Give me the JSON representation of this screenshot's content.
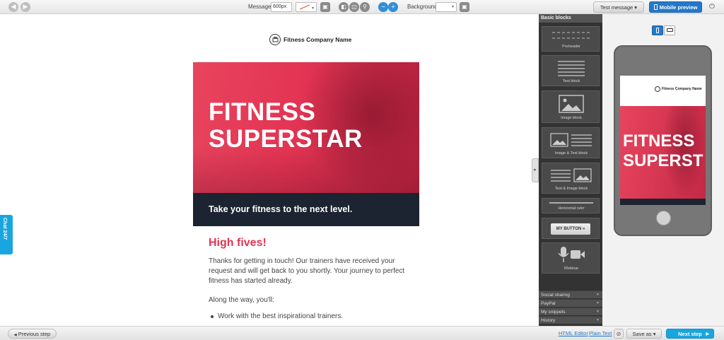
{
  "toolbar": {
    "message_label": "Message",
    "width_value": "600px",
    "background_label": "Background",
    "test_message_label": "Test message",
    "mobile_preview_label": "Mobile preview"
  },
  "email": {
    "company_name": "Fitness Company Name",
    "hero_title_line1": "FITNESS",
    "hero_title_line2": "SUPERSTAR",
    "hero_tagline": "Take your fitness to the next level.",
    "heading": "High fives!",
    "paragraph": "Thanks for getting in touch! Our trainers have received your request and will get back to you shortly. Your journey to perfect fitness has started already.",
    "paragraph2": "Along the way, you'll:",
    "bullets": [
      "Work with the best inspirational trainers."
    ]
  },
  "chat_tab_label": "Chat 24/7",
  "blocks_panel": {
    "header": "Basic blocks",
    "blocks": [
      {
        "label": "Preheader"
      },
      {
        "label": "Text block"
      },
      {
        "label": "Image block"
      },
      {
        "label": "Image & Text block"
      },
      {
        "label": "Text & Image block"
      },
      {
        "label": "Horizontal ruler"
      },
      {
        "label": "MY BUTTON »"
      },
      {
        "label": "Webinar"
      }
    ],
    "sections": [
      "Social sharing",
      "PayPal",
      "My snippets",
      "History"
    ]
  },
  "mobile_preview": {
    "company_name": "Fitness Company Name",
    "hero_title_line1": "FITNESS",
    "hero_title_line2": "SUPERST"
  },
  "bottom_bar": {
    "previous_step": "Previous step",
    "html_editor": "HTML Editor",
    "plain_text": "Plain Text",
    "save_as": "Save as",
    "next_step": "Next step"
  },
  "colors": {
    "accent_red": "#e33453",
    "dark_band": "#1b2430",
    "primary_blue": "#2578c8",
    "cyan": "#19a6e0"
  }
}
